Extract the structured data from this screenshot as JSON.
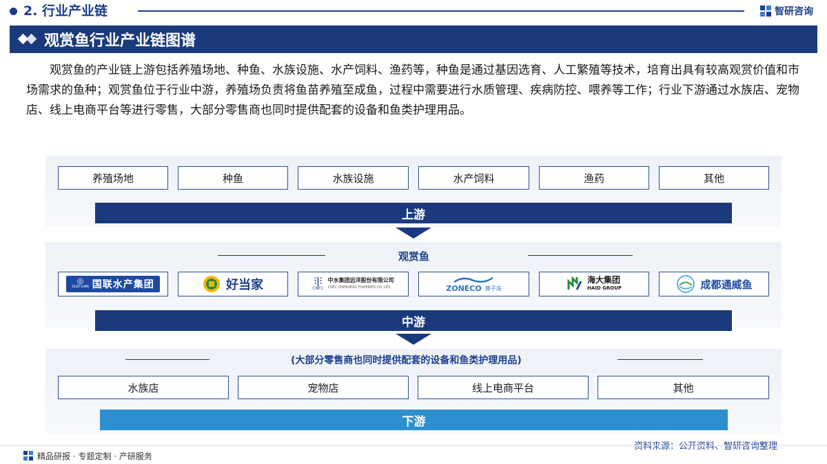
{
  "header": {
    "section_title": "2. 行业产业链",
    "brand_name": "智研咨询"
  },
  "title": "观赏鱼行业产业链图谱",
  "intro": "观赏鱼的产业链上游包括养殖场地、种鱼、水族设施、水产饲料、渔药等，种鱼是通过基因选育、人工繁殖等技术，培育出具有较高观赏价值和市场需求的鱼种；观赏鱼位于行业中游，养殖场负责将鱼苗养殖至成鱼，过程中需要进行水质管理、疾病防控、喂养等工作；行业下游通过水族店、宠物店、线上电商平台等进行零售，大部分零售商也同时提供配套的设备和鱼类护理用品。",
  "upstream": {
    "items": [
      "养殖场地",
      "种鱼",
      "水族设施",
      "水产饲料",
      "渔药",
      "其他"
    ],
    "label": "上游"
  },
  "midstream": {
    "heading": "观赏鱼",
    "logos": [
      {
        "text": "国联水产集团",
        "sub": "GUO LIAN"
      },
      {
        "text": "好当家"
      },
      {
        "text": "中水集团远洋股份有限公司",
        "sub": "CNFC OVERSEAS FISHERIES CO.,LTD.",
        "mark": "CNFC"
      },
      {
        "text": "ZONECO",
        "sub": "獐子岛"
      },
      {
        "text": "海大集团",
        "sub": "HAID GROUP"
      },
      {
        "text": "成都通威鱼"
      }
    ],
    "label": "中游"
  },
  "downstream": {
    "note": "(大部分零售商也同时提供配套的设备和鱼类护理用品)",
    "items": [
      "水族店",
      "宠物店",
      "线上电商平台",
      "其他"
    ],
    "label": "下游"
  },
  "footer": {
    "left": "精品研报 · 专题定制 · 产研服务",
    "source": "资料来源：公开资料、智研咨询整理"
  },
  "colors": {
    "navy": "#1b3a7e",
    "blue": "#2e8fd0"
  }
}
